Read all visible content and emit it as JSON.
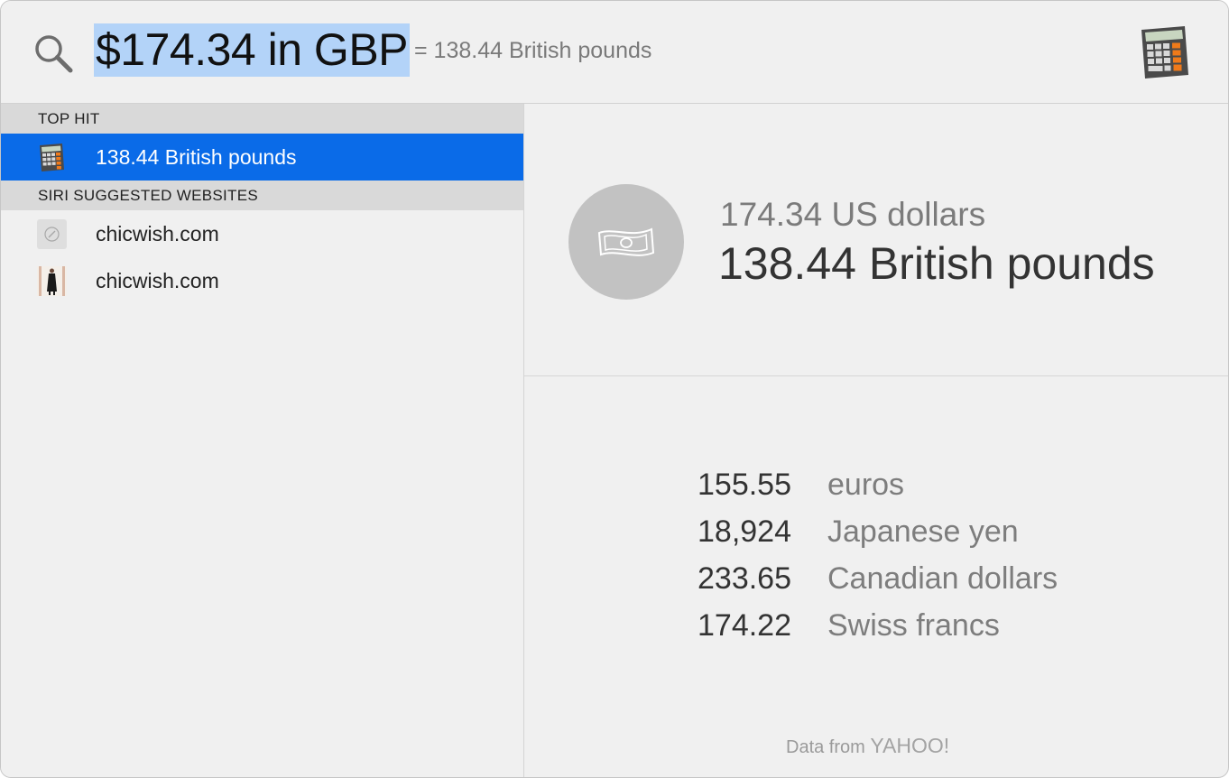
{
  "search": {
    "query": "$174.34 in GBP",
    "completion": "= 138.44 British pounds"
  },
  "icons": {
    "search": "magnifying-glass-icon",
    "app": "calculator-app-icon",
    "money": "banknote-icon",
    "safari": "compass-icon",
    "thumbnail": "website-thumbnail"
  },
  "sections": [
    {
      "header": "TOP HIT",
      "items": [
        {
          "label": "138.44 British pounds",
          "icon": "calculator-icon",
          "selected": true
        }
      ]
    },
    {
      "header": "SIRI SUGGESTED WEBSITES",
      "items": [
        {
          "label": "chicwish.com",
          "icon": "compass-icon"
        },
        {
          "label": "chicwish.com",
          "icon": "website-thumbnail"
        }
      ]
    }
  ],
  "preview": {
    "from": "174.34 US dollars",
    "to": "138.44 British pounds",
    "conversions": [
      {
        "amount": "155.55",
        "currency": "euros"
      },
      {
        "amount": "18,924",
        "currency": "Japanese yen"
      },
      {
        "amount": "233.65",
        "currency": "Canadian dollars"
      },
      {
        "amount": "174.22",
        "currency": "Swiss francs"
      }
    ],
    "attribution_prefix": "Data from",
    "attribution_brand": "YAHOO!"
  },
  "colors": {
    "selection": "#0a6be8",
    "query_highlight": "#b3d3f8",
    "window_bg": "#f0f0f0"
  }
}
